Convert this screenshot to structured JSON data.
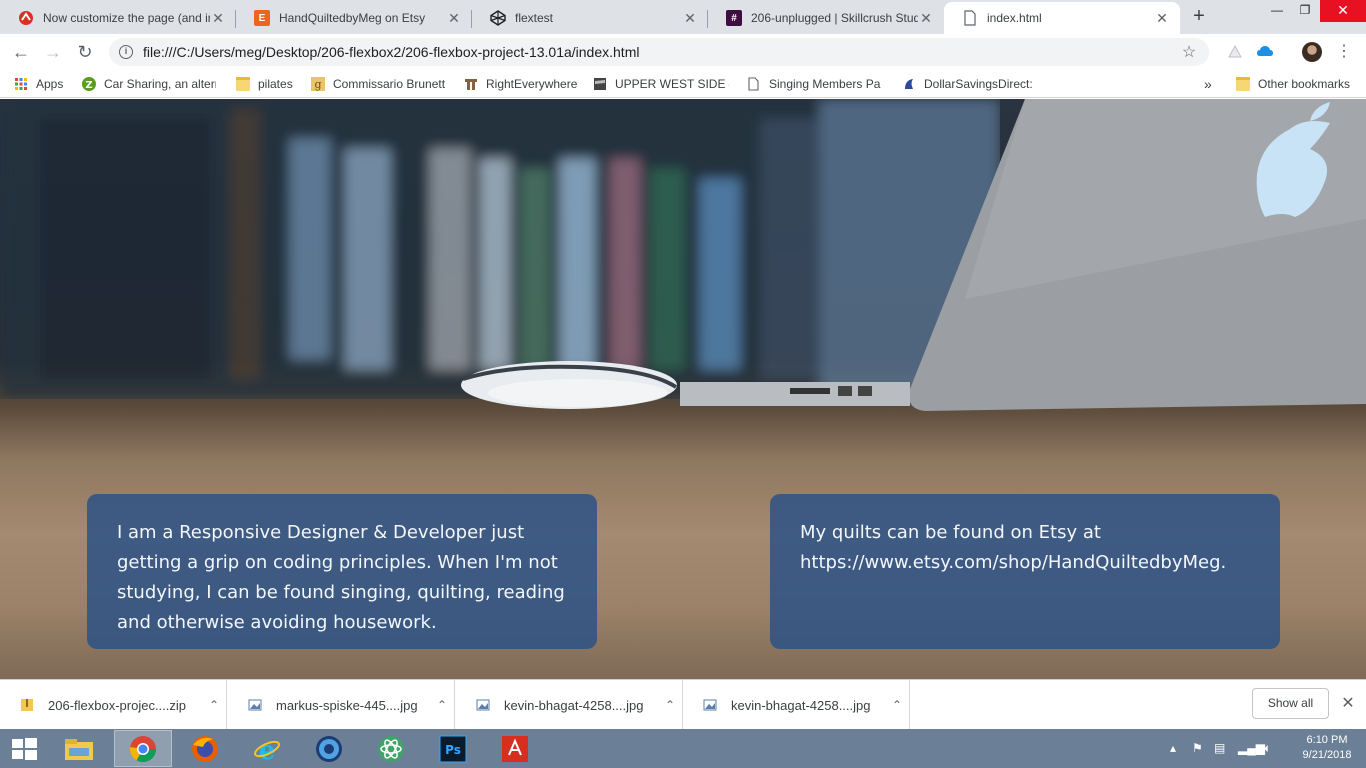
{
  "tabs": [
    {
      "title": "Now customize the page (and in",
      "favicon": "red-circle-icon",
      "active": false
    },
    {
      "title": "HandQuiltedbyMeg on Etsy",
      "favicon": "etsy-icon",
      "active": false
    },
    {
      "title": "flextest",
      "favicon": "codepen-icon",
      "active": false
    },
    {
      "title": "206-unplugged | Skillcrush Stud",
      "favicon": "slack-hash-icon",
      "active": false
    },
    {
      "title": "index.html",
      "favicon": "file-icon",
      "active": true
    }
  ],
  "toolbar": {
    "url": "file:///C:/Users/meg/Desktop/206-flexbox2/206-flexbox-project-13.01a/index.html"
  },
  "bookmarks": {
    "items": [
      {
        "label": "Apps",
        "icon": "apps-grid-icon"
      },
      {
        "label": "Car Sharing, an alterr",
        "icon": "zipcar-icon"
      },
      {
        "label": "pilates",
        "icon": "folder-icon"
      },
      {
        "label": "Commissario Brunetti",
        "icon": "g-icon"
      },
      {
        "label": "RightEverywhere",
        "icon": "building-icon"
      },
      {
        "label": "UPPER WEST SIDE —",
        "icon": "upper-west-side-icon"
      },
      {
        "label": "Singing Members Pa",
        "icon": "page-icon"
      },
      {
        "label": "DollarSavingsDirect:",
        "icon": "dollar-icon"
      }
    ],
    "overflow": "»",
    "other": "Other bookmarks"
  },
  "page": {
    "card_left_text": "I am a Responsive Designer & Developer just getting a grip on coding principles. When I'm not studying, I can be found singing, quilting, reading and otherwise avoiding housework.",
    "card_right_text": "My quilts can be found on Etsy at https://www.etsy.com/shop/HandQuiltedbyMeg."
  },
  "downloads": {
    "items": [
      {
        "name": "206-flexbox-projec....zip",
        "icon": "zip-icon"
      },
      {
        "name": "markus-spiske-445....jpg",
        "icon": "image-icon"
      },
      {
        "name": "kevin-bhagat-4258....jpg",
        "icon": "image-icon"
      },
      {
        "name": "kevin-bhagat-4258....jpg",
        "icon": "image-icon"
      }
    ],
    "show_all": "Show all"
  },
  "taskbar": {
    "apps": [
      "file-explorer-icon",
      "chrome-icon",
      "firefox-icon",
      "internet-explorer-icon",
      "itunes-icon",
      "atom-icon",
      "photoshop-icon",
      "acrobat-icon"
    ],
    "time": "6:10 PM",
    "date": "9/21/2018"
  },
  "colors": {
    "card_bg": "#285087",
    "tab_strip": "#dee1e6",
    "taskbar": "#6b7f96"
  }
}
